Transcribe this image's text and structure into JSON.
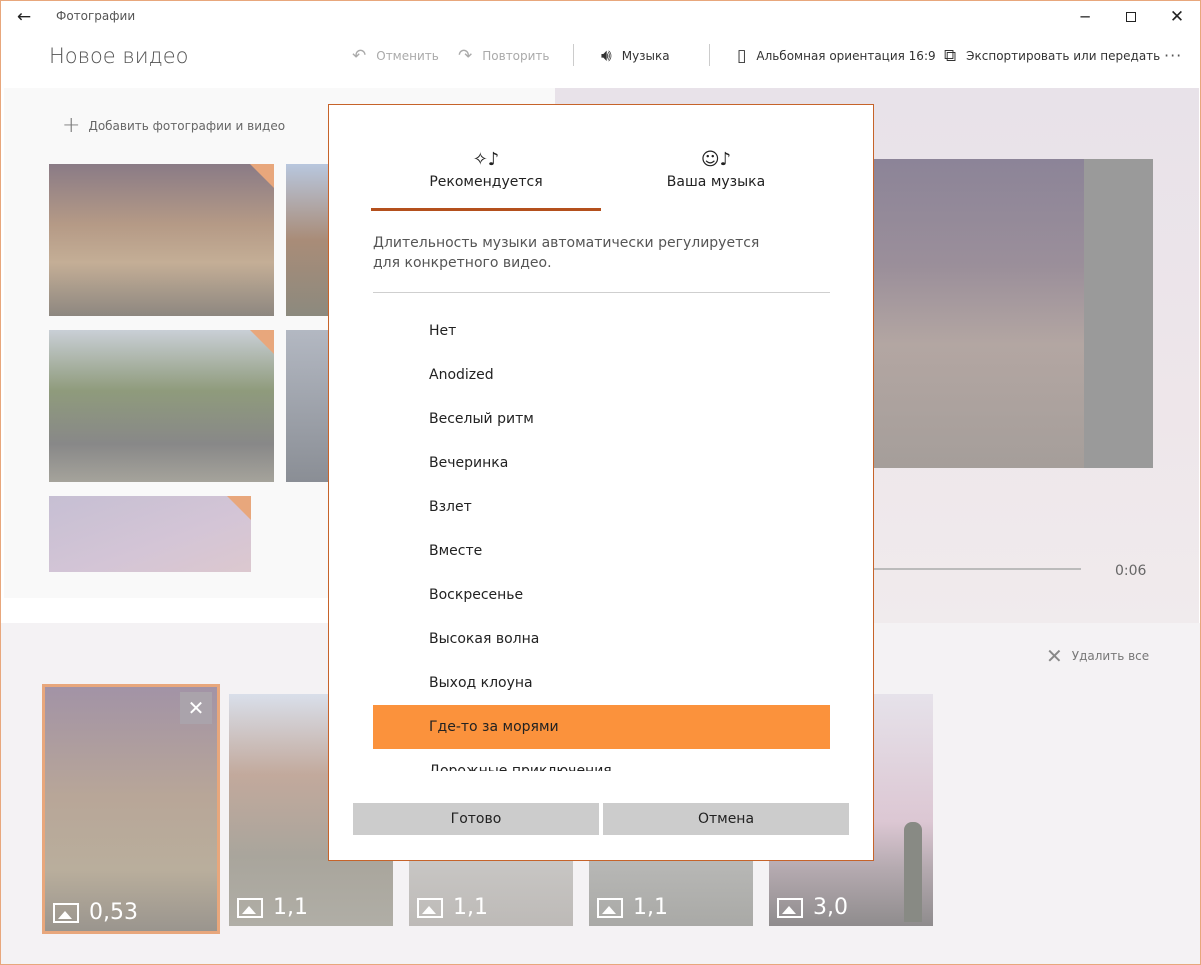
{
  "titlebar": {
    "back": "←",
    "app_title": "Фотографии",
    "minimize": "─",
    "close": "✕"
  },
  "header": {
    "title": "Новое видео",
    "undo": "Отменить",
    "redo": "Повторить",
    "music": "Музыка",
    "orientation": "Альбомная ориентация 16:9",
    "export": "Экспортировать или передать",
    "more": "···"
  },
  "library": {
    "add_media": "Добавить фотографии и видео"
  },
  "preview": {
    "duration": "0:06"
  },
  "storyboard": {
    "delete_all": "Удалить все",
    "cards": [
      {
        "duration": "0,53"
      },
      {
        "duration": "1,1"
      },
      {
        "duration": "1,1"
      },
      {
        "duration": "1,1"
      },
      {
        "duration": "3,0"
      }
    ]
  },
  "dialog": {
    "tabs": [
      {
        "label": "Рекомендуется",
        "icon": "sparkle-music-icon",
        "active": true
      },
      {
        "label": "Ваша музыка",
        "icon": "person-music-icon",
        "active": false
      }
    ],
    "description": "Длительность музыки автоматически регулируется для конкретного видео.",
    "tracks": [
      "Нет",
      "Anodized",
      "Веселый ритм",
      "Вечеринка",
      "Взлет",
      "Вместе",
      "Воскресенье",
      "Высокая волна",
      "Выход клоуна",
      "Где-то за морями",
      "Дорожные приключения"
    ],
    "selected_track": "Где-то за морями",
    "done": "Готово",
    "cancel": "Отмена"
  },
  "colors": {
    "accent": "#fb923c",
    "tab_underline": "#b4501d",
    "dialog_border": "#c6632a"
  }
}
